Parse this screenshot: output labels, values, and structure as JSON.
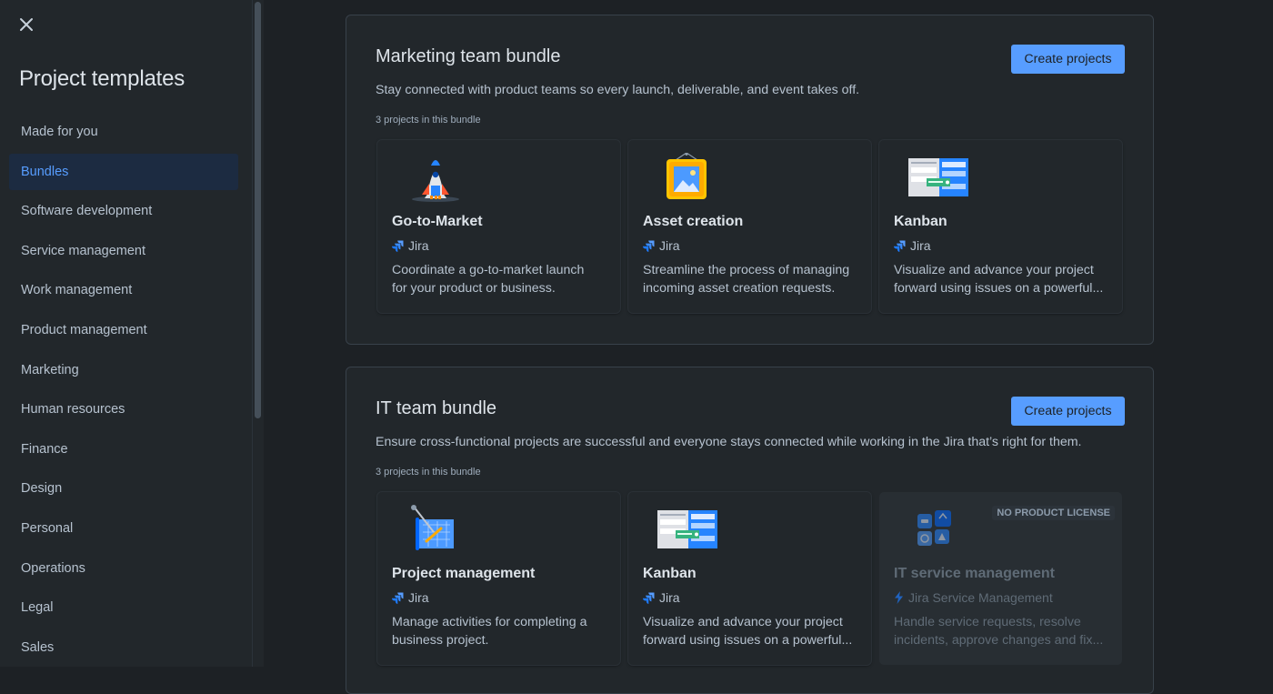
{
  "sidebar": {
    "title": "Project templates",
    "close_icon": "close-icon",
    "items": [
      {
        "label": "Made for you"
      },
      {
        "label": "Bundles",
        "active": true
      },
      {
        "label": "Software development"
      },
      {
        "label": "Service management"
      },
      {
        "label": "Work management"
      },
      {
        "label": "Product management"
      },
      {
        "label": "Marketing"
      },
      {
        "label": "Human resources"
      },
      {
        "label": "Finance"
      },
      {
        "label": "Design"
      },
      {
        "label": "Personal"
      },
      {
        "label": "Operations"
      },
      {
        "label": "Legal"
      },
      {
        "label": "Sales"
      }
    ]
  },
  "bundles": [
    {
      "title": "Marketing team bundle",
      "description": "Stay connected with product teams so every launch, deliverable, and event takes off.",
      "count": "3 projects in this bundle",
      "button": "Create projects",
      "cards": [
        {
          "title": "Go-to-Market",
          "product": "Jira",
          "icon": "rocket-icon",
          "desc_line1": "Coordinate a go-to-market launch",
          "desc_line2": "for your product or business."
        },
        {
          "title": "Asset creation",
          "product": "Jira",
          "icon": "picture-frame-icon",
          "desc_line1": "Streamline the process of managing",
          "desc_line2": "incoming asset creation requests."
        },
        {
          "title": "Kanban",
          "product": "Jira",
          "icon": "kanban-board-icon",
          "desc_line1": "Visualize and advance your project",
          "desc_line2": "forward using issues on a powerful..."
        }
      ]
    },
    {
      "title": "IT team bundle",
      "description": "Ensure cross-functional projects are successful and everyone stays connected while working in the Jira that’s right for them.",
      "count": "3 projects in this bundle",
      "button": "Create projects",
      "cards": [
        {
          "title": "Project management",
          "product": "Jira",
          "icon": "blueprint-icon",
          "desc_line1": "Manage activities for completing a",
          "desc_line2": "business project."
        },
        {
          "title": "Kanban",
          "product": "Jira",
          "icon": "kanban-board-icon",
          "desc_line1": "Visualize and advance your project",
          "desc_line2": "forward using issues on a powerful..."
        },
        {
          "title": "IT service management",
          "product": "Jira Service Management",
          "icon": "service-tiles-icon",
          "badge": "NO PRODUCT LICENSE",
          "desc_line1": "Handle service requests, resolve",
          "desc_line2": "incidents, approve changes and fix..."
        }
      ]
    }
  ],
  "colors": {
    "accent": "#579dff",
    "background": "#1d2125",
    "surface": "#22272b"
  }
}
